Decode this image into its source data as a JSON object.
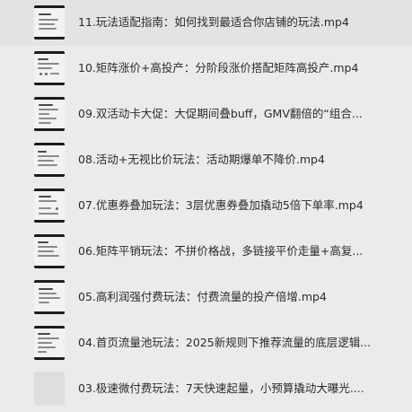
{
  "files": [
    {
      "name": "11.玩法适配指南：如何找到最适合你店铺的玩法.mp4",
      "thumb": "video-thumbnail"
    },
    {
      "name": "10.矩阵涨价+高投产：分阶段涨价搭配矩阵高投产.mp4",
      "thumb": "video-thumbnail"
    },
    {
      "name": "09.双活动卡大促：大促期间叠buff，GMV翻倍的“组合...",
      "thumb": "video-thumbnail"
    },
    {
      "name": "08.活动+无视比价玩法：活动期爆单不降价.mp4",
      "thumb": "video-thumbnail"
    },
    {
      "name": "07.优惠券叠加玩法：3层优惠券叠加撬动5倍下单率.mp4",
      "thumb": "video-thumbnail"
    },
    {
      "name": "06.矩阵平销玩法：不拼价格战，多链接平价走量+高复...",
      "thumb": "video-thumbnail"
    },
    {
      "name": "05.高利润强付费玩法：付费流量的投产倍增.mp4",
      "thumb": "video-thumbnail"
    },
    {
      "name": "04.首页流量池玩法：2025新规则下推荐流量的底层逻辑...",
      "thumb": "video-thumbnail"
    },
    {
      "name": "03.极速微付费玩法：7天快速起量，小预算撬动大曝光....",
      "thumb": "video-thumbnail-blank"
    }
  ]
}
